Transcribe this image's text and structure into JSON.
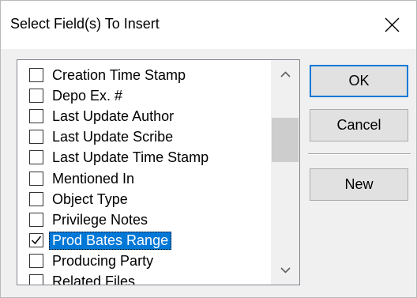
{
  "dialog": {
    "title": "Select Field(s) To Insert",
    "close_icon": "close-icon"
  },
  "fields": [
    {
      "label": "Creation Time Stamp",
      "checked": false,
      "selected": false
    },
    {
      "label": "Depo Ex. #",
      "checked": false,
      "selected": false
    },
    {
      "label": "Last Update Author",
      "checked": false,
      "selected": false
    },
    {
      "label": "Last Update Scribe",
      "checked": false,
      "selected": false
    },
    {
      "label": "Last Update Time Stamp",
      "checked": false,
      "selected": false
    },
    {
      "label": "Mentioned In",
      "checked": false,
      "selected": false
    },
    {
      "label": "Object Type",
      "checked": false,
      "selected": false
    },
    {
      "label": "Privilege Notes",
      "checked": false,
      "selected": false
    },
    {
      "label": "Prod Bates Range",
      "checked": true,
      "selected": true
    },
    {
      "label": "Producing Party",
      "checked": false,
      "selected": false
    },
    {
      "label": "Related Files",
      "checked": false,
      "selected": false
    }
  ],
  "buttons": {
    "ok": "OK",
    "cancel": "Cancel",
    "new": "New"
  },
  "colors": {
    "selection": "#0078d7",
    "default_button_border": "#0078d7"
  }
}
